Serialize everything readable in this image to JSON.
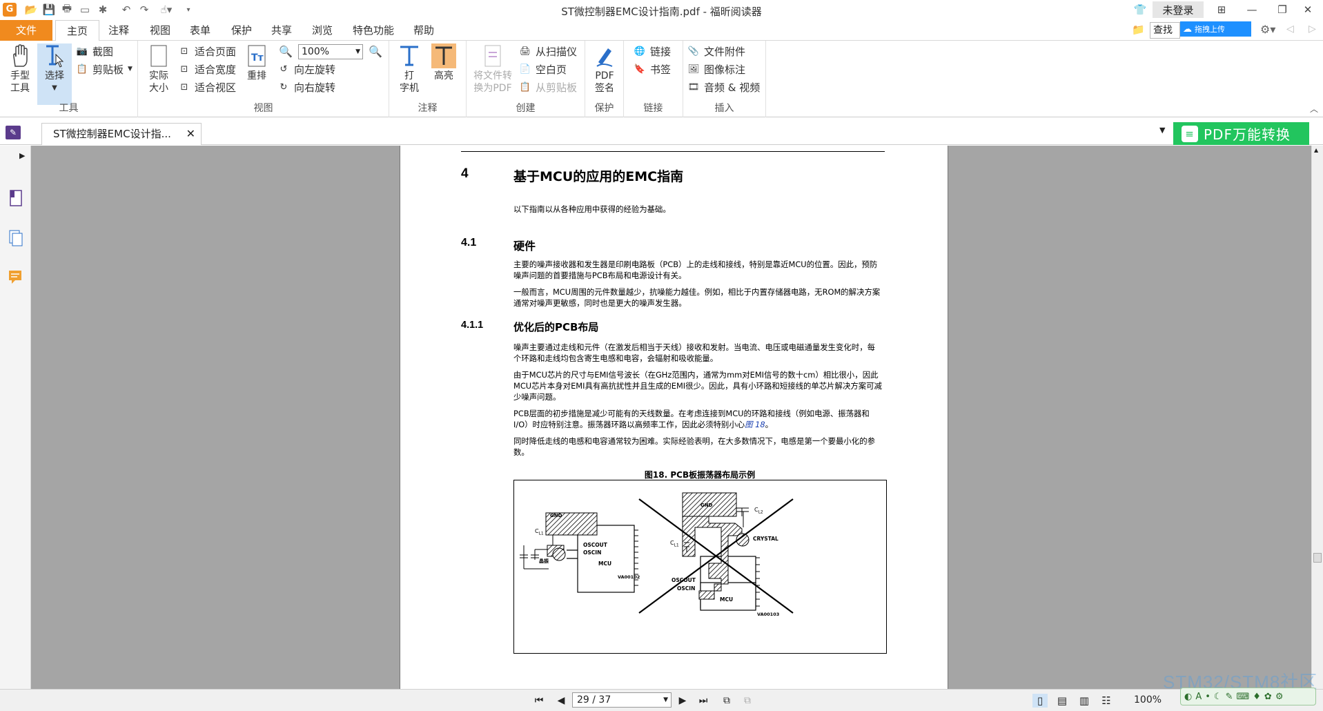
{
  "window": {
    "title": "ST微控制器EMC设计指南.pdf - 福昕阅读器",
    "login_label": "未登录"
  },
  "menu": {
    "tabs": [
      "文件",
      "主页",
      "注释",
      "视图",
      "表单",
      "保护",
      "共享",
      "浏览",
      "特色功能",
      "帮助"
    ],
    "search_placeholder": "查找",
    "upload_label": "拖拽上传"
  },
  "ribbon": {
    "tools_group": {
      "label": "工具",
      "hand": "手型\n工具",
      "select": "选择",
      "screenshot": "截图",
      "clipboard": "剪贴板"
    },
    "view_group": {
      "label": "视图",
      "actual_size": "实际\n大小",
      "fit_page": "适合页面",
      "fit_width": "适合宽度",
      "fit_visible": "适合视区",
      "reflow": "重排",
      "zoom_value": "100%",
      "rotate_left": "向左旋转",
      "rotate_right": "向右旋转"
    },
    "annot_group": {
      "label": "注释",
      "typewriter": "打\n字机",
      "highlight": "高亮"
    },
    "create_group": {
      "label": "创建",
      "to_pdf": "将文件转\n换为PDF",
      "from_scanner": "从扫描仪",
      "blank_page": "空白页",
      "from_clipboard": "从剪贴板"
    },
    "protect_group": {
      "label": "保护",
      "pdf_sign": "PDF\n签名"
    },
    "link_group": {
      "label": "链接",
      "link": "链接",
      "bookmark": "书签"
    },
    "insert_group": {
      "label": "插入",
      "attachment": "文件附件",
      "image_annot": "图像标注",
      "audio_video": "音频 & 视频"
    }
  },
  "doc_tab": {
    "label": "ST微控制器EMC设计指...",
    "convert_label": "PDF万能转换"
  },
  "page": {
    "h4_num": "4",
    "h4_title": "基于MCU的应用的EMC指南",
    "intro": "以下指南以从各种应用中获得的经验为基础。",
    "h41_num": "4.1",
    "h41_title": "硬件",
    "p1": "主要的噪声接收器和发生器是印刷电路板（PCB）上的走线和接线，特别是靠近MCU的位置。因此，预防噪声问题的首要措施与PCB布局和电源设计有关。",
    "p2": "一般而言，MCU周围的元件数量越少，抗噪能力越佳。例如，相比于内置存储器电路，无ROM的解决方案通常对噪声更敏感，同时也是更大的噪声发生器。",
    "h411_num": "4.1.1",
    "h411_title": "优化后的PCB布局",
    "p3": "噪声主要通过走线和元件（在激发后相当于天线）接收和发射。当电流、电压或电磁通量发生变化时，每个环路和走线均包含寄生电感和电容，会辐射和吸收能量。",
    "p4": "由于MCU芯片的尺寸与EMI信号波长（在GHz范围内，通常为mm对EMI信号的数十cm）相比很小，因此MCU芯片本身对EMI具有高抗扰性并且生成的EMI很少。因此，具有小环路和短接线的单芯片解决方案可减少噪声问题。",
    "p5_pre": "PCB层面的初步措施是减少可能有的天线数量。在考虑连接到MCU的环路和接线（例如电源、振荡器和I/O）时应特别注意。振荡器环路以高频率工作，因此必须特别小心",
    "p5_link": "图 18",
    "p5_post": "。",
    "p6": "同时降低走线的电感和电容通常较为困难。实际经验表明，在大多数情况下，电感是第一个要最小化的参数。",
    "fig_caption": "图18. PCB板振荡器布局示例",
    "fig": {
      "left_gnd": "GND",
      "left_cl1": "C",
      "left_cl1_sub": "L1",
      "left_oscout": "OSCOUT",
      "left_oscin": "OSCIN",
      "left_mcu": "MCU",
      "left_crystal": "晶振",
      "left_code": "VA00102",
      "right_gnd": "GND",
      "right_cl2": "C",
      "right_cl2_sub": "L2",
      "right_cl1": "C",
      "right_cl1_sub": "L1",
      "right_crystal": "CRYSTAL",
      "right_oscout": "OSCOUT",
      "right_oscin": "OSCIN",
      "right_mcu": "MCU",
      "right_code": "VA00103"
    }
  },
  "status": {
    "page_value": "29 / 37",
    "zoom": "100%",
    "watermark": "STM32/STM8社区"
  }
}
